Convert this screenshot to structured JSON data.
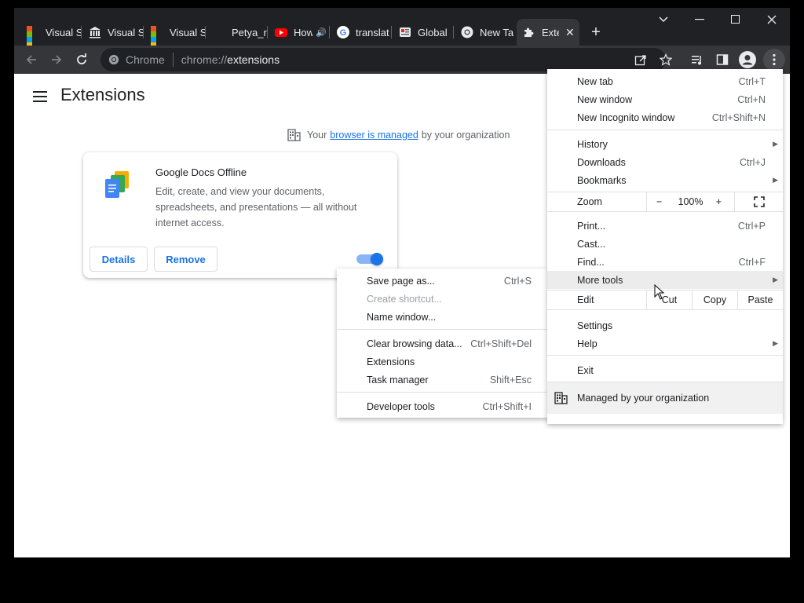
{
  "tabs": [
    {
      "label": "Visual S",
      "icon": "microsoft-icon"
    },
    {
      "label": "Visual S",
      "icon": "institution-icon"
    },
    {
      "label": "Visual S",
      "icon": "microsoft-icon"
    },
    {
      "label": "Petya_r",
      "icon": "blank-icon"
    },
    {
      "label": "How",
      "icon": "youtube-icon"
    },
    {
      "label": "translat",
      "icon": "google-icon"
    },
    {
      "label": "Global",
      "icon": "news-icon"
    },
    {
      "label": "New Ta",
      "icon": "chrome-icon"
    },
    {
      "label": "Exte",
      "icon": "puzzle-icon",
      "active": true
    }
  ],
  "omnibox": {
    "chip": "Chrome",
    "scheme": "chrome://",
    "host": "extensions"
  },
  "page": {
    "title": "Extensions",
    "managed_prefix": "Your",
    "managed_link": "browser is managed",
    "managed_suffix": "by your organization"
  },
  "extension": {
    "name": "Google Docs Offline",
    "description": "Edit, create, and view your documents, spreadsheets, and presentations — all without internet access.",
    "details_label": "Details",
    "remove_label": "Remove",
    "enabled": true
  },
  "main_menu": {
    "new_tab": {
      "label": "New tab",
      "shortcut": "Ctrl+T"
    },
    "new_window": {
      "label": "New window",
      "shortcut": "Ctrl+N"
    },
    "new_incognito": {
      "label": "New Incognito window",
      "shortcut": "Ctrl+Shift+N"
    },
    "history": {
      "label": "History"
    },
    "downloads": {
      "label": "Downloads",
      "shortcut": "Ctrl+J"
    },
    "bookmarks": {
      "label": "Bookmarks"
    },
    "zoom": {
      "label": "Zoom",
      "minus": "−",
      "value": "100%",
      "plus": "+"
    },
    "print": {
      "label": "Print...",
      "shortcut": "Ctrl+P"
    },
    "cast": {
      "label": "Cast..."
    },
    "find": {
      "label": "Find...",
      "shortcut": "Ctrl+F"
    },
    "more_tools": {
      "label": "More tools"
    },
    "edit": {
      "label": "Edit",
      "cut": "Cut",
      "copy": "Copy",
      "paste": "Paste"
    },
    "settings": {
      "label": "Settings"
    },
    "help": {
      "label": "Help"
    },
    "exit": {
      "label": "Exit"
    },
    "managed": {
      "label": "Managed by your organization"
    }
  },
  "submenu": {
    "save_page": {
      "label": "Save page as...",
      "shortcut": "Ctrl+S"
    },
    "create_shortcut": {
      "label": "Create shortcut..."
    },
    "name_window": {
      "label": "Name window..."
    },
    "clear_data": {
      "label": "Clear browsing data...",
      "shortcut": "Ctrl+Shift+Del"
    },
    "extensions": {
      "label": "Extensions"
    },
    "task_manager": {
      "label": "Task manager",
      "shortcut": "Shift+Esc"
    },
    "dev_tools": {
      "label": "Developer tools",
      "shortcut": "Ctrl+Shift+I"
    }
  },
  "colors": {
    "accent": "#1a73e8",
    "toolbar": "#35363a",
    "tabstrip": "#202124"
  }
}
